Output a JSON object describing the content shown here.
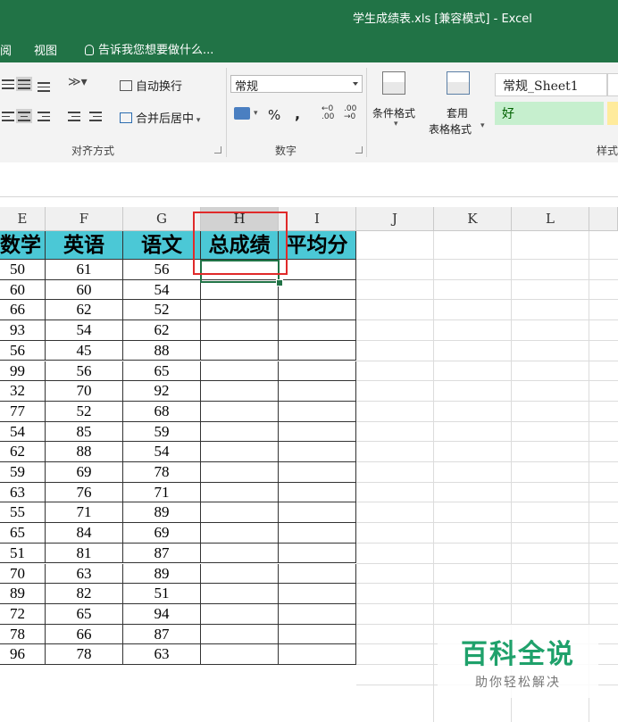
{
  "window": {
    "title": "学生成绩表.xls  [兼容模式] - Excel"
  },
  "tabs": [
    {
      "label": "阅"
    },
    {
      "label": "视图"
    }
  ],
  "tellme": {
    "placeholder": "告诉我您想要做什么..."
  },
  "ribbon": {
    "wrap_text": "自动换行",
    "merge_center": "合并后居中",
    "alignment_group": "对齐方式",
    "number_format": "常规",
    "percent": "%",
    "comma": ",",
    "inc_decimal": "←0 .00",
    "dec_decimal": ".00 →0",
    "number_group": "数字",
    "conditional_format": "条件格式",
    "format_table_1": "套用",
    "format_table_2": "表格格式",
    "style_normal": "常规_Sheet1",
    "style_good": "好",
    "styles_group": "样式"
  },
  "columns": [
    "E",
    "F",
    "G",
    "H",
    "I",
    "J",
    "K",
    "L"
  ],
  "selected_column": "H",
  "headers": [
    "数学",
    "英语",
    "语文",
    "总成绩",
    "平均分"
  ],
  "rows": [
    [
      "50",
      "61",
      "56"
    ],
    [
      "60",
      "60",
      "54"
    ],
    [
      "66",
      "62",
      "52"
    ],
    [
      "93",
      "54",
      "62"
    ],
    [
      "56",
      "45",
      "88"
    ],
    [
      "99",
      "56",
      "65"
    ],
    [
      "32",
      "70",
      "92"
    ],
    [
      "77",
      "52",
      "68"
    ],
    [
      "54",
      "85",
      "59"
    ],
    [
      "62",
      "88",
      "54"
    ],
    [
      "59",
      "69",
      "78"
    ],
    [
      "63",
      "76",
      "71"
    ],
    [
      "55",
      "71",
      "89"
    ],
    [
      "65",
      "84",
      "69"
    ],
    [
      "51",
      "81",
      "87"
    ],
    [
      "70",
      "63",
      "89"
    ],
    [
      "89",
      "82",
      "51"
    ],
    [
      "72",
      "65",
      "94"
    ],
    [
      "78",
      "66",
      "87"
    ],
    [
      "96",
      "78",
      "63"
    ]
  ],
  "watermark": {
    "main": "百科全说",
    "sub": "助你轻松解决"
  },
  "colors": {
    "excel_green": "#217346",
    "header_fill": "#4bc8d6",
    "highlight": "#e02a2a",
    "watermark": "#1fa16b"
  }
}
